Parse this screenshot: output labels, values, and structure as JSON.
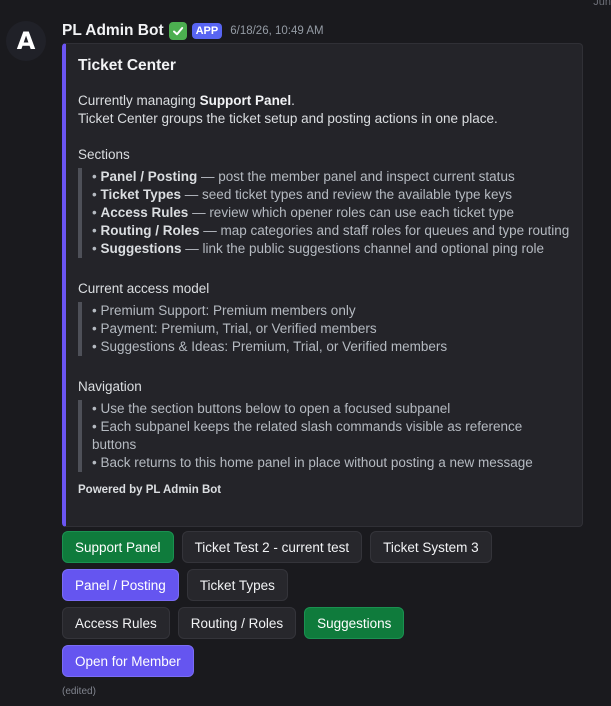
{
  "corner_text": "Jun",
  "message": {
    "avatar_letter": "A",
    "username": "PL Admin Bot",
    "badge": "APP",
    "timestamp": "6/18/26, 10:49 AM",
    "edited": "(edited)"
  },
  "embed": {
    "title": "Ticket Center",
    "intro1_prefix": "Currently managing ",
    "intro1_bold": "Support Panel",
    "intro1_suffix": ".",
    "intro2": "Ticket Center groups the ticket setup and posting actions in one place.",
    "sections_title": "Sections",
    "sections": [
      {
        "name": "Panel / Posting",
        "desc": " — post the member panel and inspect current status"
      },
      {
        "name": "Ticket Types",
        "desc": " — seed ticket types and review the available type keys"
      },
      {
        "name": "Access Rules",
        "desc": " — review which opener roles can use each ticket type"
      },
      {
        "name": "Routing / Roles",
        "desc": " — map categories and staff roles for queues and type routing"
      },
      {
        "name": "Suggestions",
        "desc": " — link the public suggestions channel and optional ping role"
      }
    ],
    "access_title": "Current access model",
    "access": [
      "Premium Support: Premium members only",
      "Payment: Premium, Trial, or Verified members",
      "Suggestions & Ideas: Premium, Trial, or Verified members"
    ],
    "nav_title": "Navigation",
    "nav": [
      "Use the section buttons below to open a focused subpanel",
      "Each subpanel keeps the related slash commands visible as reference buttons",
      "Back returns to this home panel in place without posting a new message"
    ],
    "bullet": "•",
    "footer": "Powered by PL Admin Bot"
  },
  "buttons": {
    "row1": [
      "Support Panel",
      "Ticket Test 2 - current test",
      "Ticket System 3"
    ],
    "row2": [
      "Panel / Posting",
      "Ticket Types"
    ],
    "row3": [
      "Access Rules",
      "Routing / Roles",
      "Suggestions"
    ],
    "row4": [
      "Open for Member"
    ]
  },
  "colors": {
    "embed_accent": "#6b55f2",
    "button_green": "#0f7b3c",
    "button_purple": "#6555f0",
    "button_gray": "#27272c",
    "background": "#1a1a1e"
  },
  "icons": {
    "verified": "check-mark-icon",
    "avatar": "bot-logo-icon"
  }
}
